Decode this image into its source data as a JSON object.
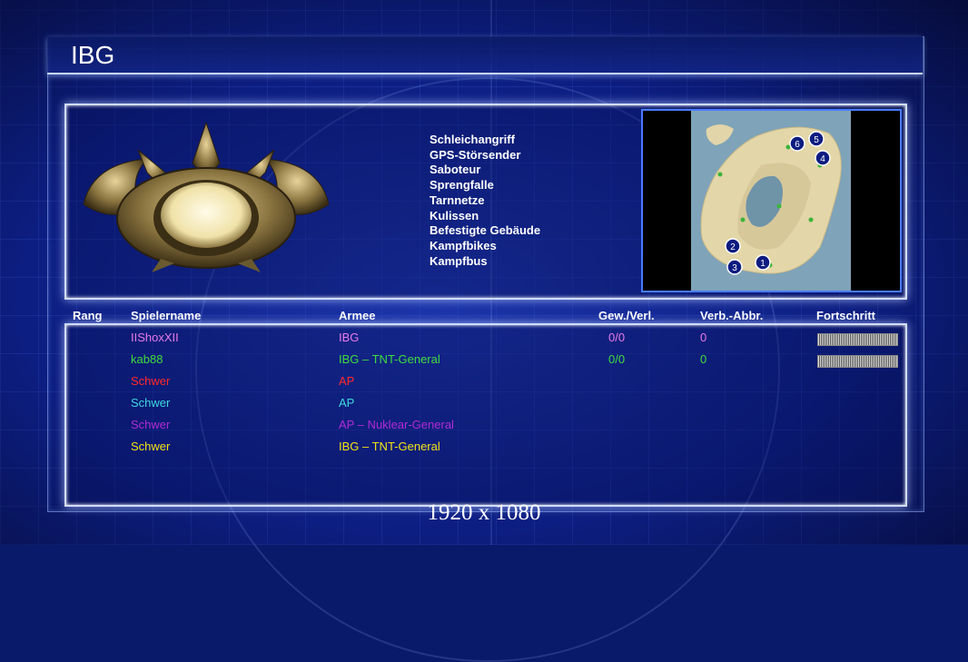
{
  "title": "IBG",
  "features": [
    "Schleichangriff",
    "GPS-Störsender",
    "Saboteur",
    "Sprengfalle",
    "Tarnnetze",
    "Kulissen",
    "Befestigte Gebäude",
    "Kampfbikes",
    "Kampfbus"
  ],
  "columns": {
    "rank": "Rang",
    "player": "Spielername",
    "army": "Armee",
    "winloss": "Gew./Verl.",
    "disconnects": "Verb.-Abbr.",
    "progress": "Fortschritt"
  },
  "players": [
    {
      "name": "IIShoxXII",
      "army": "IBG",
      "winloss": "0/0",
      "disconnects": "0",
      "color": "#e77ae8",
      "show_progress": true
    },
    {
      "name": "kab88",
      "army": "IBG – TNT-General",
      "winloss": "0/0",
      "disconnects": "0",
      "color": "#3fdc3f",
      "show_progress": true
    },
    {
      "name": "Schwer",
      "army": "AP",
      "winloss": "",
      "disconnects": "",
      "color": "#ff2a2a",
      "show_progress": false
    },
    {
      "name": "Schwer",
      "army": "AP",
      "winloss": "",
      "disconnects": "",
      "color": "#3fd8e0",
      "show_progress": false
    },
    {
      "name": "Schwer",
      "army": "AP – Nuklear-General",
      "winloss": "",
      "disconnects": "",
      "color": "#b22ad8",
      "show_progress": false
    },
    {
      "name": "Schwer",
      "army": "IBG – TNT-General",
      "winloss": "",
      "disconnects": "",
      "color": "#f2e21a",
      "show_progress": false
    }
  ],
  "map_start_positions": [
    "1",
    "2",
    "3",
    "4",
    "5",
    "6"
  ],
  "resolution_text": "1920 x 1080",
  "icons": {
    "faction_emblem": "gla-emblem-icon"
  }
}
